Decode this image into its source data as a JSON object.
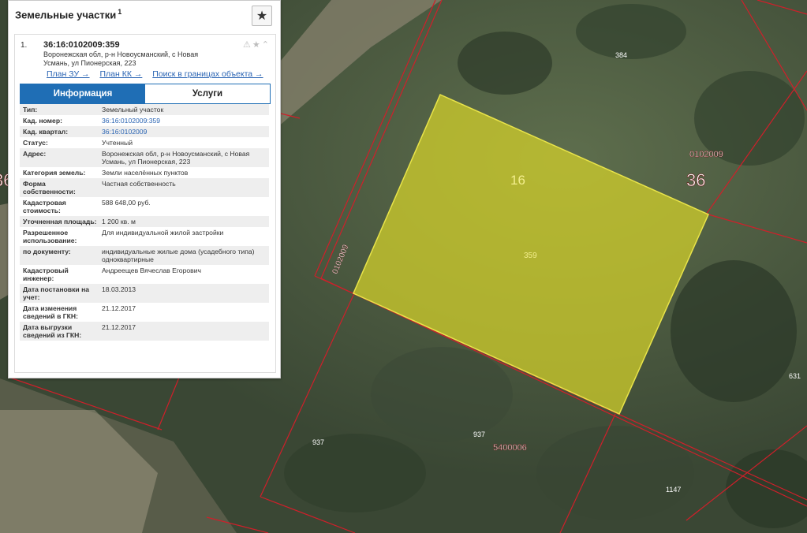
{
  "panel": {
    "title": "Земельные участки",
    "title_count": "1",
    "star_icon": "star-icon"
  },
  "record": {
    "index": "1.",
    "cad_number": "36:16:0102009:359",
    "address": "Воронежская обл, р-н Новоусманский, с Новая Усмань, ул Пионерская, 223",
    "links": [
      "План ЗУ →",
      "План КК →",
      "Поиск в границах объекта →"
    ]
  },
  "tabs": {
    "info": "Информация",
    "services": "Услуги"
  },
  "fields": [
    {
      "label": "Тип:",
      "value": "Земельный участок"
    },
    {
      "label": "Кад. номер:",
      "value": "36:16:0102009:359"
    },
    {
      "label": "Кад. квартал:",
      "value": "36:16:0102009"
    },
    {
      "label": "Статус:",
      "value": "Учтенный"
    },
    {
      "label": "Адрес:",
      "value": "Воронежская обл, р-н Новоусманский, с Новая Усмань, ул Пионерская, 223"
    },
    {
      "label": "Категория земель:",
      "value": "Земли населённых пунктов"
    },
    {
      "label": "Форма собственности:",
      "value": "Частная собственность"
    },
    {
      "label": "Кадастровая стоимость:",
      "value": "588 648,00 руб."
    },
    {
      "label": "Уточненная площадь:",
      "value": "1 200 кв. м"
    },
    {
      "label": "Разрешенное использование:",
      "value": "Для индивидуальной жилой застройки"
    },
    {
      "label": "по документу:",
      "value": "индивидуальные жилые дома (усадебного типа) одноквартирные"
    },
    {
      "label": "Кадастровый инженер:",
      "value": "Андреещев Вячеслав Егорович"
    },
    {
      "label": "Дата постановки на учет:",
      "value": "18.03.2013"
    },
    {
      "label": "Дата изменения сведений в ГКН:",
      "value": "21.12.2017"
    },
    {
      "label": "Дата выгрузки сведений из ГКН:",
      "value": "21.12.2017"
    }
  ],
  "map_labels": {
    "plot_number": "16",
    "plot_id": "359",
    "region": "36",
    "quarter": "0102009",
    "quarter_rotated": "0102009",
    "n384": "384",
    "n937a": "937",
    "n937b": "937",
    "n5400006": "5400006",
    "n1147": "1147",
    "n631": "631",
    "n36left": "36"
  },
  "colors": {
    "highlight": "#d6d32a",
    "boundary": "#d01f2a",
    "tab_active": "#1f6eb5",
    "link": "#2a64b3"
  }
}
